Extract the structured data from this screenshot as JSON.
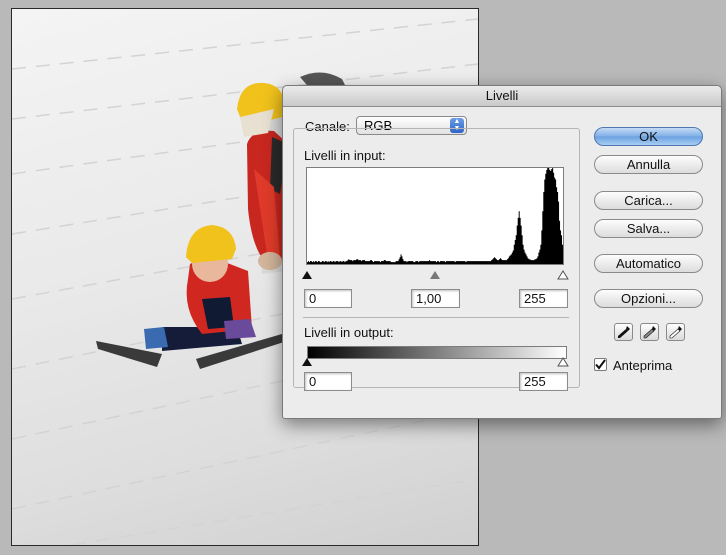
{
  "dialog": {
    "title": "Livelli",
    "channel_label": "Canale:",
    "channel_value": "RGB",
    "input_levels_label": "Livelli in input:",
    "input_black": "0",
    "input_gamma": "1,00",
    "input_white": "255",
    "output_levels_label": "Livelli in output:",
    "output_black": "0",
    "output_white": "255",
    "buttons": {
      "ok": "OK",
      "cancel": "Annulla",
      "load": "Carica...",
      "save": "Salva...",
      "auto": "Automatico",
      "options": "Opzioni..."
    },
    "preview_label": "Anteprima",
    "preview_checked": true
  },
  "histogram": {
    "bins": [
      2,
      3,
      2,
      3,
      3,
      2,
      3,
      2,
      3,
      3,
      2,
      3,
      3,
      2,
      2,
      3,
      3,
      2,
      3,
      3,
      2,
      3,
      2,
      3,
      3,
      2,
      3,
      3,
      2,
      3,
      3,
      3,
      2,
      3,
      3,
      2,
      3,
      3,
      2,
      3,
      3,
      4,
      5,
      4,
      4,
      4,
      3,
      4,
      4,
      4,
      5,
      5,
      4,
      4,
      4,
      3,
      4,
      4,
      4,
      3,
      3,
      3,
      3,
      3,
      4,
      4,
      3,
      2,
      3,
      3,
      3,
      3,
      3,
      3,
      2,
      3,
      3,
      3,
      4,
      4,
      3,
      3,
      3,
      3,
      3,
      2,
      2,
      2,
      2,
      2,
      3,
      3,
      3,
      5,
      7,
      10,
      8,
      5,
      3,
      3,
      3,
      2,
      3,
      3,
      3,
      3,
      3,
      3,
      2,
      2,
      3,
      3,
      3,
      2,
      3,
      3,
      3,
      3,
      3,
      3,
      3,
      3,
      3,
      3,
      4,
      3,
      3,
      3,
      3,
      3,
      3,
      2,
      3,
      3,
      2,
      3,
      3,
      3,
      3,
      3,
      2,
      3,
      3,
      3,
      3,
      3,
      3,
      3,
      3,
      3,
      2,
      3,
      3,
      3,
      3,
      3,
      3,
      3,
      3,
      3,
      3,
      2,
      3,
      3,
      3,
      3,
      3,
      3,
      3,
      3,
      3,
      3,
      3,
      3,
      3,
      3,
      3,
      3,
      3,
      3,
      3,
      3,
      3,
      3,
      3,
      3,
      3,
      4,
      5,
      6,
      7,
      6,
      5,
      4,
      4,
      5,
      6,
      5,
      4,
      4,
      4,
      4,
      4,
      5,
      6,
      8,
      9,
      10,
      12,
      14,
      20,
      25,
      30,
      40,
      48,
      55,
      48,
      40,
      30,
      20,
      15,
      12,
      10,
      8,
      6,
      5,
      5,
      4,
      4,
      4,
      4,
      5,
      5,
      6,
      8,
      12,
      15,
      20,
      35,
      55,
      75,
      88,
      94,
      98,
      100,
      100,
      98,
      97,
      99,
      100,
      95,
      90,
      88,
      80,
      75,
      65,
      45,
      35,
      30,
      20
    ]
  },
  "colors": {
    "default_button": "#6aa0e0",
    "dialog_bg": "#ececec",
    "desktop_bg": "#b9b9b9"
  }
}
